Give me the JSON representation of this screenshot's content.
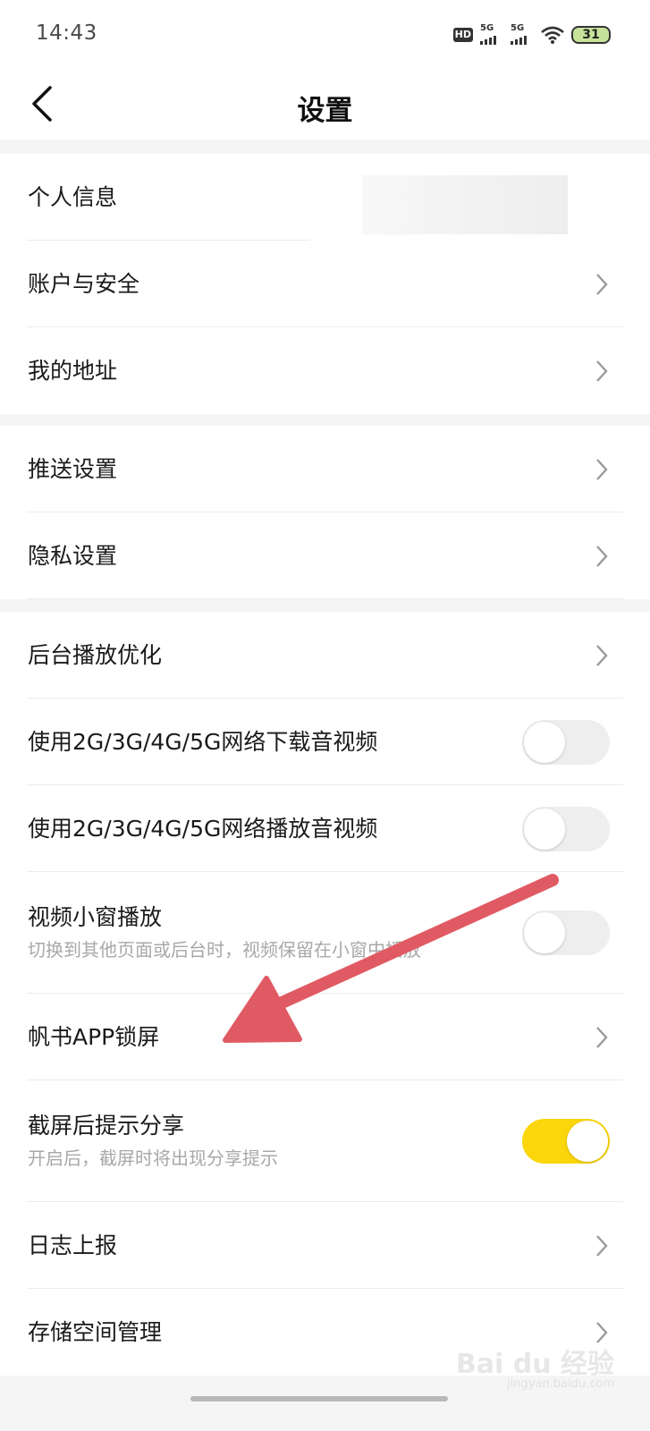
{
  "status_bar": {
    "time": "14:43",
    "hd_label": "HD",
    "signal1_label": "5G",
    "signal2_label": "5G",
    "battery": "31"
  },
  "nav": {
    "title": "设置"
  },
  "groups": [
    {
      "rows": [
        {
          "label": "个人信息"
        },
        {
          "label": "账户与安全"
        },
        {
          "label": "我的地址"
        }
      ]
    },
    {
      "rows": [
        {
          "label": "推送设置"
        },
        {
          "label": "隐私设置"
        }
      ]
    },
    {
      "rows": [
        {
          "label": "后台播放优化"
        },
        {
          "label": "使用2G/3G/4G/5G网络下载音视频",
          "toggle": false
        },
        {
          "label": "使用2G/3G/4G/5G网络播放音视频",
          "toggle": false
        },
        {
          "label": "视频小窗播放",
          "sub": "切换到其他页面或后台时，视频保留在小窗中播放",
          "toggle": false
        },
        {
          "label": "帆书APP锁屏"
        },
        {
          "label": "截屏后提示分享",
          "sub": "开启后，截屏时将出现分享提示",
          "toggle": true
        },
        {
          "label": "日志上报"
        },
        {
          "label": "存储空间管理"
        }
      ]
    }
  ],
  "watermark": {
    "main": "Bai du 经验",
    "sub": "jingyan.baidu.com"
  },
  "colors": {
    "accent_toggle_on": "#fbd60a",
    "annotation_arrow": "#e05a63",
    "background": "#f5f5f5"
  }
}
